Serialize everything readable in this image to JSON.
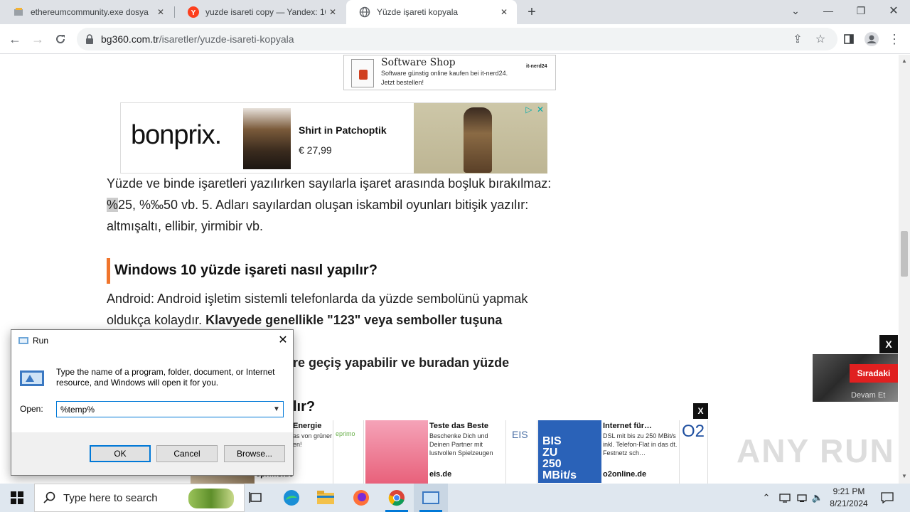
{
  "browser": {
    "tabs": [
      {
        "title": "ethereumcommunity.exe dosya",
        "active": false
      },
      {
        "title": "yuzde isareti copy — Yandex: 10",
        "active": false
      },
      {
        "title": "Yüzde işareti kopyala",
        "active": true
      }
    ],
    "url_host": "bg360.com.tr",
    "url_path": "/isaretler/yuzde-isareti-kopyala"
  },
  "page": {
    "ad_top": {
      "title": "Software Shop",
      "text": "Software günstig online kaufen bei it-nerd24. Jetzt bestellen!",
      "logo": "it-nerd24"
    },
    "ad_bonprix": {
      "brand": "bonprix.",
      "product": "Shirt in Patchoptik",
      "price": "€ 27,99"
    },
    "paragraph1_highlight": "%",
    "paragraph1": "25, %‰50 vb. 5. Adları sayılardan oluşan iskambil oyunları bitişik yazılır: altmışaltı, ellibir, yirmibir vb.",
    "paragraph1_first": "Yüzde ve binde işaretleri yazılırken sayılarla işaret arasında boşluk bırakılmaz:",
    "heading1": "Windows 10 yüzde işareti nasıl yapılır?",
    "paragraph2_normal": "Android: Android işletim sistemli telefonlarda da yüzde sembolünü yapmak oldukça kolaydır. ",
    "paragraph2_bold": "Klavyede genellikle \"123\" veya semboller tuşuna basarak",
    "paragraph2_line3": "re geçiş yapabilir ve buradan yüzde",
    "heading2_fragment": "lır?",
    "video": {
      "close": "X",
      "next_label": "Sıradaki",
      "more_label": "Devam Et"
    },
    "bottom_ads": {
      "close": "X",
      "ad1_title": "Energie",
      "ad1_text": "as von grüner en!",
      "ad1_domain": "eprimo.de",
      "ad1_logo": "eprimo",
      "ad2_title": "Teste das Beste",
      "ad2_text": "Beschenke Dich und Deinen Partner mit lustvollen Spielzeugen",
      "ad2_domain": "eis.de",
      "ad2_logo": "EIS",
      "ad3_title": "Internet für…",
      "ad3_text": "DSL mit bis zu 250 MBit/s inkl. Telefon-Flat in das dt. Festnetz sch…",
      "ad3_domain": "o2online.de",
      "ad3_logo": "O2",
      "ad3_banner": "BIS ZU 250 MBit/s"
    },
    "watermark": "ANY RUN"
  },
  "run_dialog": {
    "title": "Run",
    "description": "Type the name of a program, folder, document, or Internet resource, and Windows will open it for you.",
    "open_label": "Open:",
    "open_value": "%temp%",
    "ok_label": "OK",
    "cancel_label": "Cancel",
    "browse_label": "Browse..."
  },
  "taskbar": {
    "search_placeholder": "Type here to search",
    "time": "9:21 PM",
    "date": "8/21/2024"
  }
}
